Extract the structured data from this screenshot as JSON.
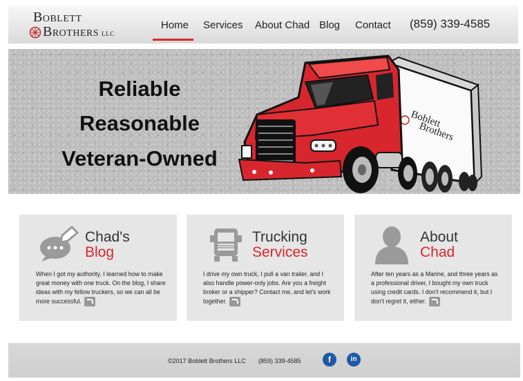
{
  "logo": {
    "line1": "Boblett",
    "line2": "Brothers",
    "suffix": "llc"
  },
  "nav": {
    "items": [
      {
        "label": "Home",
        "active": true
      },
      {
        "label": "Services"
      },
      {
        "label": "About Chad"
      },
      {
        "label": "Blog"
      },
      {
        "label": "Contact"
      }
    ],
    "phone": "(859) 339-4585",
    "accent": "#d8262e"
  },
  "hero": {
    "lines": [
      "Reliable",
      "Reasonable",
      "Veteran-Owned"
    ],
    "truck_logo": {
      "line1": "Boblett",
      "line2": "Brothers"
    }
  },
  "cards": [
    {
      "title1": "Chad's",
      "title2": "Blog",
      "icon": "chat-bubble-icon",
      "body": "When I got my authority, I learned how to make great money with one truck. On the blog, I share ideas with my fellow truckers, so we can all be more successful."
    },
    {
      "title1": "Trucking",
      "title2": "Services",
      "icon": "truck-icon",
      "body": "I drive my own truck, I pull a van trailer, and I also handle power-only jobs. Are you a freight broker or a shipper? Contact me, and let's work together."
    },
    {
      "title1": "About",
      "title2": "Chad",
      "icon": "person-icon",
      "body": "After ten years as a Marine, and three years as a professional driver, I bought my own truck using credit cards. I don't recommend it, but I don't regret it, either."
    }
  ],
  "footer": {
    "copyright": "©2017 Boblett Brothers LLC",
    "phone": "(859) 339-4585",
    "social": [
      {
        "label": "f",
        "icon": "facebook-icon"
      },
      {
        "label": "in",
        "icon": "linkedin-icon"
      }
    ]
  }
}
